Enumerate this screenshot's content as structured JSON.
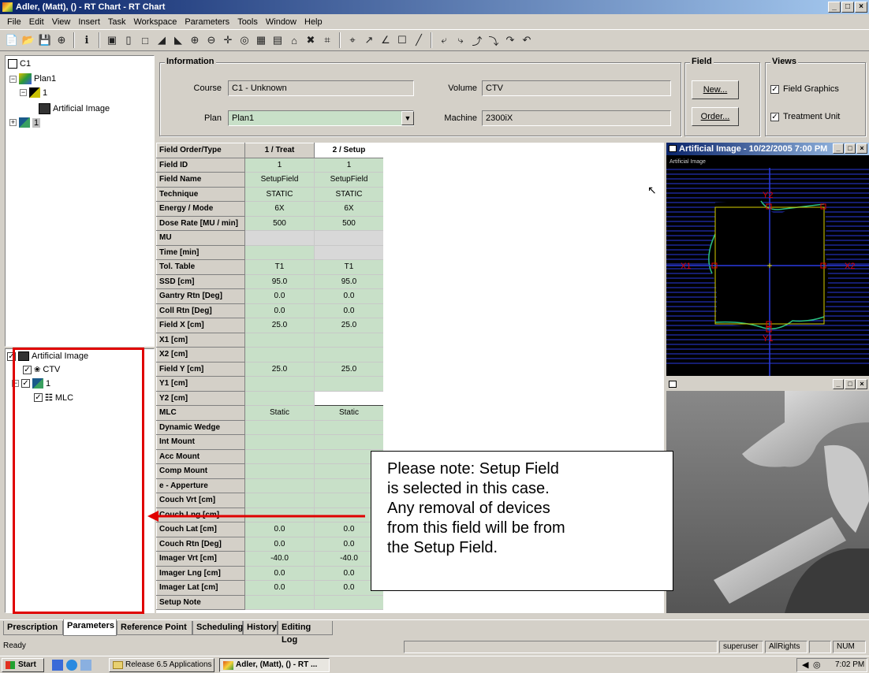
{
  "window": {
    "title": "Adler, (Matt), () - RT Chart - RT Chart",
    "controls": [
      "_",
      "□",
      "×"
    ]
  },
  "menu": [
    "File",
    "Edit",
    "View",
    "Insert",
    "Task",
    "Workspace",
    "Parameters",
    "Tools",
    "Window",
    "Help"
  ],
  "tree_top": {
    "course": "C1",
    "plan": "Plan1",
    "node1": "1",
    "image": "Artificial Image",
    "node2": "1"
  },
  "tree_bottom": {
    "image": "Artificial Image",
    "structure": "CTV",
    "field": "1",
    "device": "MLC"
  },
  "information": {
    "legend": "Information",
    "course_label": "Course",
    "course_value": "C1 - Unknown",
    "plan_label": "Plan",
    "plan_value": "Plan1",
    "volume_label": "Volume",
    "volume_value": "CTV",
    "machine_label": "Machine",
    "machine_value": "2300iX"
  },
  "field": {
    "legend": "Field",
    "new_button": "New...",
    "order_button": "Order..."
  },
  "views": {
    "legend": "Views",
    "field_graphics": "Field Graphics",
    "treatment_unit": "Treatment Unit"
  },
  "grid": {
    "header": [
      "Field Order/Type",
      "1 / Treat",
      "2 / Setup"
    ],
    "rows": [
      {
        "label": "Field ID",
        "c1": "1",
        "c2": "1",
        "style": "v"
      },
      {
        "label": "Field Name",
        "c1": "SetupField",
        "c2": "SetupField",
        "style": "v"
      },
      {
        "label": "Technique",
        "c1": "STATIC",
        "c2": "STATIC",
        "style": "v"
      },
      {
        "label": "Energy / Mode",
        "c1": "6X",
        "c2": "6X",
        "style": "v"
      },
      {
        "label": "Dose Rate [MU / min]",
        "c1": "500",
        "c2": "500",
        "style": "v"
      },
      {
        "label": "MU",
        "c1": "",
        "c2": "",
        "style": "g"
      },
      {
        "label": "Time [min]",
        "c1": "",
        "c2": "",
        "style": "vg"
      },
      {
        "label": "Tol. Table",
        "c1": "T1",
        "c2": "T1",
        "style": "v"
      },
      {
        "label": "SSD [cm]",
        "c1": "95.0",
        "c2": "95.0",
        "style": "v"
      },
      {
        "label": "Gantry Rtn [Deg]",
        "c1": "0.0",
        "c2": "0.0",
        "style": "v"
      },
      {
        "label": "Coll Rtn [Deg]",
        "c1": "0.0",
        "c2": "0.0",
        "style": "v"
      },
      {
        "label": "Field X [cm]",
        "c1": "25.0",
        "c2": "25.0",
        "style": "v"
      },
      {
        "label": "X1 [cm]",
        "c1": "",
        "c2": "",
        "style": "v"
      },
      {
        "label": "X2 [cm]",
        "c1": "",
        "c2": "",
        "style": "v"
      },
      {
        "label": "Field Y [cm]",
        "c1": "25.0",
        "c2": "25.0",
        "style": "v"
      },
      {
        "label": "Y1 [cm]",
        "c1": "",
        "c2": "",
        "style": "v"
      },
      {
        "label": "Y2 [cm]",
        "c1": "",
        "c2": "",
        "style": "vw"
      },
      {
        "label": "MLC",
        "c1": "Static",
        "c2": "Static",
        "style": "v"
      },
      {
        "label": "Dynamic Wedge",
        "c1": "",
        "c2": "",
        "style": "v"
      },
      {
        "label": "Int Mount",
        "c1": "",
        "c2": "",
        "style": "v"
      },
      {
        "label": "Acc Mount",
        "c1": "",
        "c2": "",
        "style": "v"
      },
      {
        "label": "Comp Mount",
        "c1": "",
        "c2": "",
        "style": "v"
      },
      {
        "label": "e - Apperture",
        "c1": "",
        "c2": "",
        "style": "v"
      },
      {
        "label": "Couch Vrt [cm]",
        "c1": "",
        "c2": "",
        "style": "v"
      },
      {
        "label": "Couch Lng [cm]",
        "c1": "",
        "c2": "",
        "style": "v"
      },
      {
        "label": "Couch Lat [cm]",
        "c1": "0.0",
        "c2": "0.0",
        "style": "v"
      },
      {
        "label": "Couch Rtn [Deg]",
        "c1": "0.0",
        "c2": "0.0",
        "style": "v"
      },
      {
        "label": "Imager Vrt [cm]",
        "c1": "-40.0",
        "c2": "-40.0",
        "style": "v"
      },
      {
        "label": "Imager Lng [cm]",
        "c1": "0.0",
        "c2": "0.0",
        "style": "v"
      },
      {
        "label": "Imager Lat [cm]",
        "c1": "0.0",
        "c2": "0.0",
        "style": "v"
      },
      {
        "label": "Setup Note",
        "c1": "",
        "c2": "",
        "style": "v"
      }
    ]
  },
  "image_window": {
    "title": "Artificial Image - 10/22/2005 7:00 PM",
    "caption": "Artificial Image",
    "labels": {
      "y2": "Y2",
      "y1": "Y1",
      "x1": "X1",
      "x2": "X2"
    }
  },
  "callout": {
    "lines": [
      "Please note: Setup Field",
      "is selected in this case.",
      "Any removal of devices",
      "from this field will be from",
      "the Setup Field."
    ]
  },
  "tabs": [
    "Prescription",
    "Parameters",
    "Reference Point",
    "Scheduling",
    "History",
    "Editing Log"
  ],
  "status": {
    "ready": "Ready",
    "user": "superuser",
    "rights": "AllRights",
    "num": "NUM"
  },
  "taskbar": {
    "start": "Start",
    "task1": "Release 6.5 Applications",
    "task2": "Adler, (Matt), () - RT ...",
    "clock": "7:02 PM"
  },
  "colors": {
    "title_gradient_start": "#0a246a",
    "grid_green": "#c8e0c8",
    "callout_arrow": "#e00000",
    "highlight_box": "#e00000",
    "image_bg": "#000080"
  }
}
